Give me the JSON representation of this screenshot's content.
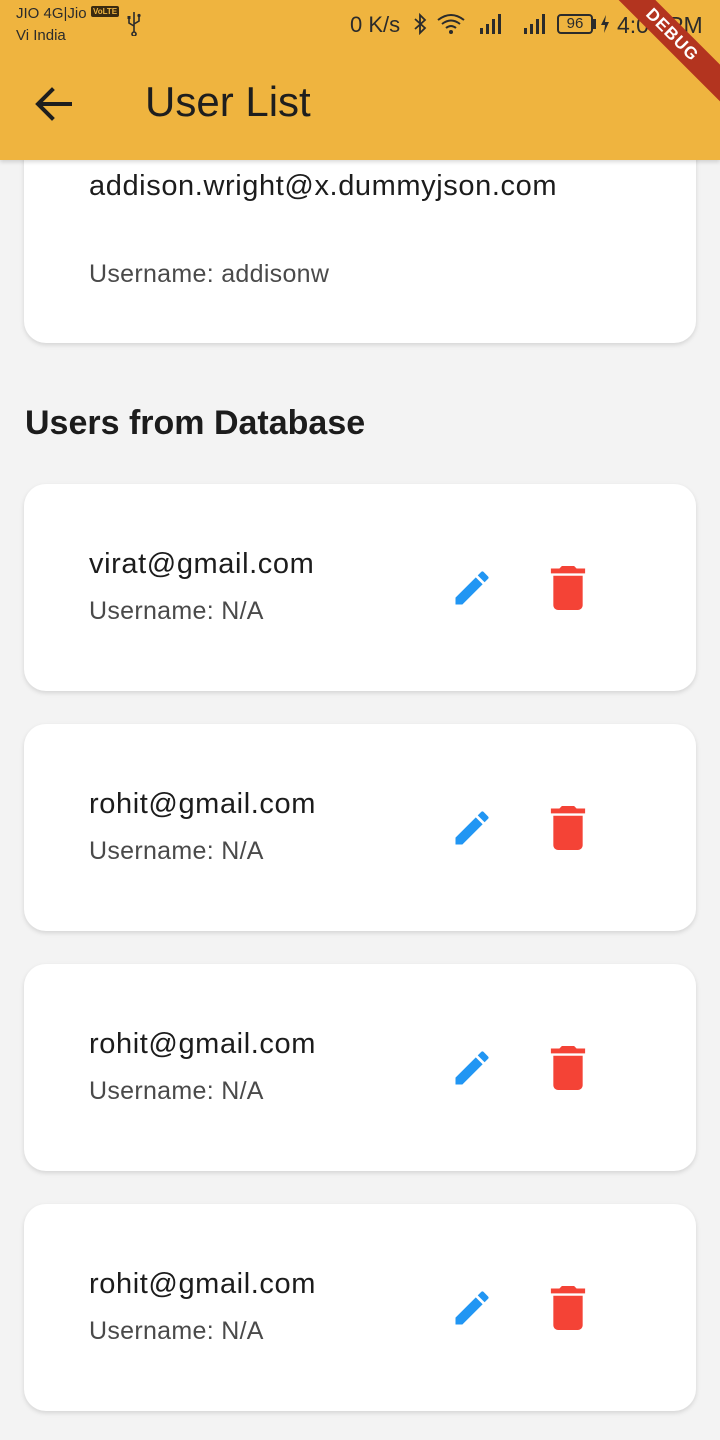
{
  "status_bar": {
    "carrier_line1": "JIO 4G|Jio",
    "volte_badge": "VoLTE",
    "carrier_line2": "Vi India",
    "net_speed": "0 K/s",
    "battery": "96",
    "time": "4:05 PM"
  },
  "debug_banner": "DEBUG",
  "app_bar": {
    "title": "User List"
  },
  "api_users": [
    {
      "email": "addison.wright@x.dummyjson.com",
      "username": "Username: addisonw"
    }
  ],
  "section_title": "Users from Database",
  "db_users": [
    {
      "email": "virat@gmail.com",
      "username": "Username: N/A"
    },
    {
      "email": "rohit@gmail.com",
      "username": "Username: N/A"
    },
    {
      "email": "rohit@gmail.com",
      "username": "Username: N/A"
    },
    {
      "email": "rohit@gmail.com",
      "username": "Username: N/A"
    }
  ],
  "colors": {
    "app_bar": "#efb43f",
    "edit_icon": "#2196f3",
    "delete_icon": "#f44336",
    "background": "#f3f3f3"
  },
  "icons": [
    "back-arrow-icon",
    "edit-icon",
    "delete-icon"
  ]
}
